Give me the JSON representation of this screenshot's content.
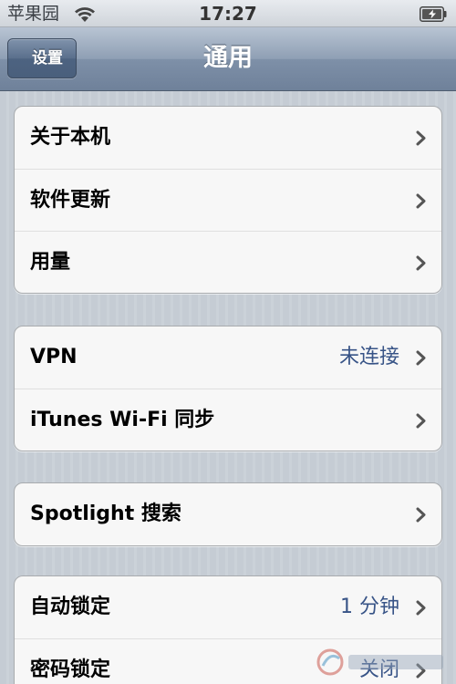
{
  "status_bar": {
    "carrier": "苹果园",
    "time": "17:27",
    "icons": [
      "wifi-icon",
      "battery-icon"
    ]
  },
  "nav": {
    "back_label": "设置",
    "title": "通用"
  },
  "groups": [
    {
      "rows": [
        {
          "label": "关于本机"
        },
        {
          "label": "软件更新"
        },
        {
          "label": "用量"
        }
      ]
    },
    {
      "rows": [
        {
          "label": "VPN",
          "value": "未连接"
        },
        {
          "label": "iTunes Wi-Fi 同步"
        }
      ]
    },
    {
      "rows": [
        {
          "label": "Spotlight 搜索"
        }
      ]
    },
    {
      "rows": [
        {
          "label": "自动锁定",
          "value": "1 分钟"
        },
        {
          "label": "密码锁定",
          "value": "关闭"
        }
      ]
    }
  ],
  "colors": {
    "value_text": "#385487",
    "nav_bar": "#7e90a8",
    "background": "#c5ccd4"
  }
}
